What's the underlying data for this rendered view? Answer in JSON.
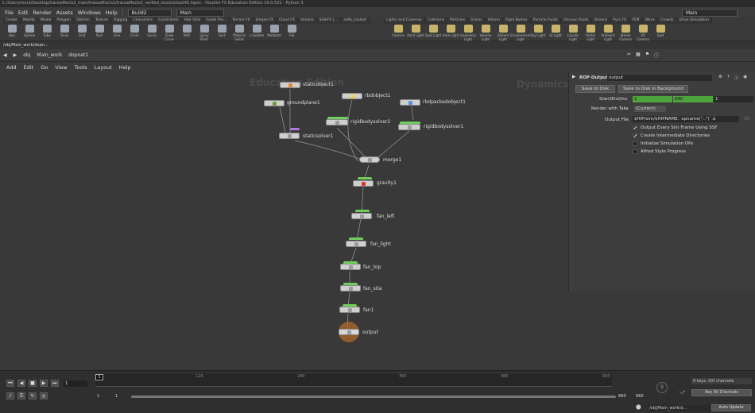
{
  "window": {
    "title": "C:/Users/ment/Desktop/transeffects2_main/transeffects2/transeffects2_verfied_shoot/shoot45.hipnc - Houdini FX Education Edition 19.0.531 - Python 3"
  },
  "menu": [
    "File",
    "Edit",
    "Render",
    "Assets",
    "Windows",
    "Help"
  ],
  "desktop": "Build2",
  "context": "Main",
  "right_context": "Main",
  "shelf_tabs_left": [
    "Create",
    "Modify",
    "Model",
    "Polygon",
    "Deform",
    "Texture",
    "Rigging",
    "Characters",
    "Constraints",
    "Hair Utils",
    "Guide Pro...",
    "Terrain FX",
    "Simple FX",
    "Cloud FX",
    "Volume",
    "SideFX L...",
    "sidfx_toolset"
  ],
  "shelf_tabs_right": [
    "Lights and Cameras",
    "Collisions",
    "Particles",
    "Grains",
    "Vellum",
    "Rigid Bodies",
    "Particle Fluids",
    "Viscous Fluids",
    "Oceans",
    "Pyro FX",
    "FEM",
    "Wires",
    "Crowds",
    "Drive Simulation"
  ],
  "tools_left": [
    "Box",
    "Sphere",
    "Tube",
    "Torus",
    "Grid",
    "Null",
    "Line",
    "Circle",
    "Curve",
    "Draw Curve",
    "Path",
    "Spray Paint",
    "Font",
    "Platonic Solids",
    "L-System",
    "Metaball",
    "File"
  ],
  "tools_right": [
    "Camera",
    "Point Light",
    "Spot Light",
    "Area Light",
    "Geometry Light",
    "Volume Light",
    "Distant Light",
    "Environment Light",
    "Sky Light",
    "GI Light",
    "Caustic Light",
    "Portal Light",
    "Ambient Light",
    "Stereo Camera",
    "VR Camera",
    "Swit"
  ],
  "path_tab": "/obj/Main_work/dopn...",
  "netbar": {
    "obj": "obj",
    "work": "Main_work",
    "net": "dopnet1"
  },
  "net_menu": [
    "Add",
    "Edit",
    "Go",
    "View",
    "Tools",
    "Layout",
    "Help"
  ],
  "watermarks": {
    "left": "Education Edition",
    "right": "Dynamics"
  },
  "nodes": {
    "staticobject1": "staticobject1",
    "groundplane1": "groundplane1",
    "rbdobject1": "rbdobject1",
    "rbdpackedobject1": "rbdpackedobject1",
    "rigidbodysolver2": "rigidbodysolver2",
    "rigidbodysolver1": "rigidbodysolver1",
    "staticsolver1": "staticsolver1",
    "merge1": "merge1",
    "gravity1": "gravity1",
    "fan_left": "fan_left",
    "fan_light": "fan_light",
    "fan_top": "fan_top",
    "fan_sita": "fan_sita",
    "fan1": "fan1",
    "output": "output"
  },
  "parm": {
    "type": "ROP Output",
    "name": "output",
    "save_disk": "Save to Disk",
    "save_bg": "Save to Disk in Background",
    "start_label": "Start/End/Inc",
    "start": "1",
    "end": "660",
    "inc": "1",
    "take_label": "Render with Take",
    "take": "(Current)",
    "file_label": "Output File",
    "file": "$HIP/sim/$HIPNAME.`opname(\"..\")`.$",
    "checks": [
      {
        "label": "Output Every Sim Frame Using SSF",
        "on": true
      },
      {
        "label": "Create Intermediate Directories",
        "on": true
      },
      {
        "label": "Initialize Simulation OPs",
        "on": false
      },
      {
        "label": "Alfred Style Progress",
        "on": false
      }
    ]
  },
  "timeline": {
    "current": "1",
    "ticks": [
      "120",
      "240",
      "360",
      "480",
      "600"
    ],
    "start": "1",
    "start2": "1",
    "end": "660",
    "end2": "660",
    "keys": "0 keys, 0/0 channels",
    "key_all": "Key All Channels",
    "status_path": "/obj/Main_work/d...",
    "auto_update": "Auto Update"
  }
}
